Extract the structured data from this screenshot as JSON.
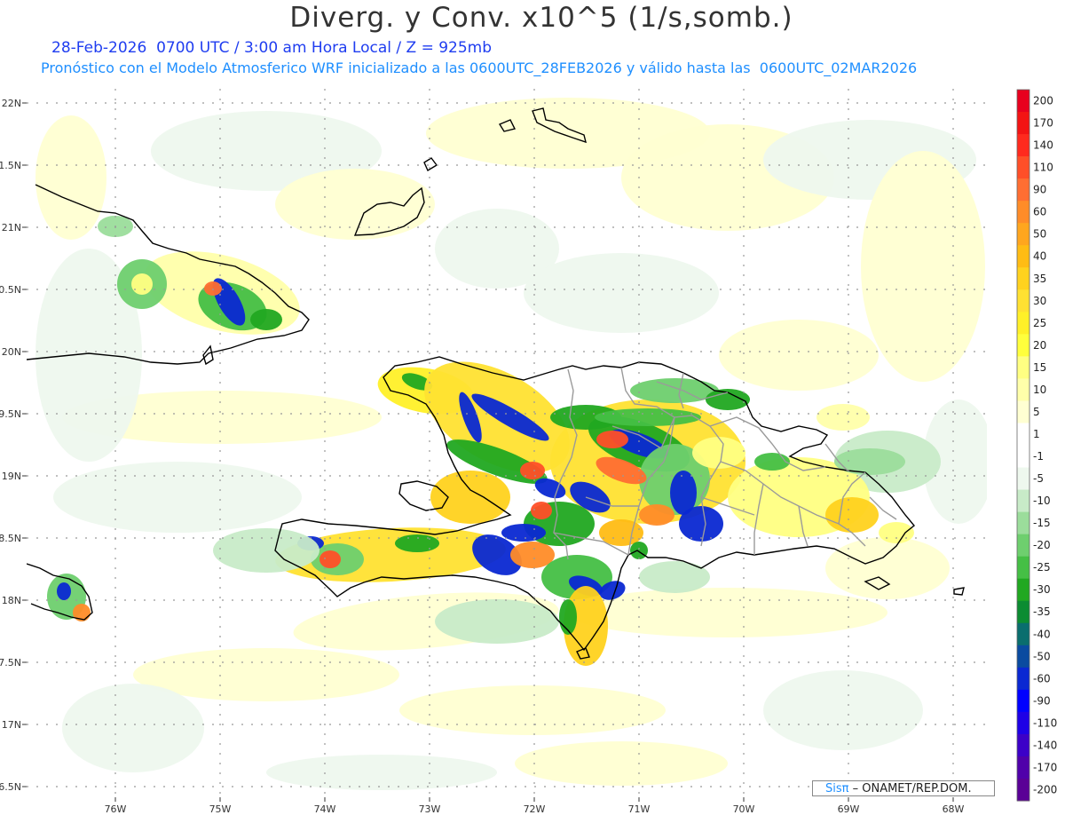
{
  "header": {
    "title": "Diverg. y Conv. x10^5 (1/s,somb.)",
    "subtitle1": "28-Feb-2026  0700 UTC / 3:00 am Hora Local / Z = 925mb",
    "subtitle2": "Pronóstico con el Modelo Atmosferico WRF inicializado a las 0600UTC_28FEB2026 y válido hasta las  0600UTC_02MAR2026"
  },
  "map": {
    "lat_labels": [
      "22N",
      "21.5N",
      "21N",
      "20.5N",
      "20N",
      "19.5N",
      "19N",
      "18.5N",
      "18N",
      "17.5N",
      "17N",
      "16.5N"
    ],
    "lon_labels": [
      "76W",
      "75W",
      "74W",
      "73W",
      "72W",
      "71W",
      "70W",
      "69W",
      "68W"
    ],
    "lat_values": [
      22,
      21.5,
      21,
      20.5,
      20,
      19.5,
      19,
      18.5,
      18,
      17.5,
      17,
      16.5
    ],
    "lon_values": [
      -76,
      -75,
      -74,
      -73,
      -72,
      -71,
      -70,
      -69,
      -68
    ]
  },
  "legend": {
    "labels": [
      "200",
      "170",
      "140",
      "110",
      "90",
      "60",
      "50",
      "40",
      "35",
      "30",
      "25",
      "20",
      "15",
      "10",
      "5",
      "1",
      "-1",
      "-5",
      "-10",
      "-15",
      "-20",
      "-25",
      "-30",
      "-35",
      "-40",
      "-50",
      "-60",
      "-90",
      "-110",
      "-140",
      "-170",
      "-200"
    ],
    "colors": [
      "#e8001e",
      "#f31414",
      "#ff2a1e",
      "#ff4f28",
      "#ff6e32",
      "#ff8c28",
      "#ffa61e",
      "#ffbc14",
      "#ffd21e",
      "#ffe132",
      "#fff028",
      "#ffff3c",
      "#ffff82",
      "#ffffaa",
      "#ffffd2",
      "#ffffff",
      "#ffffff",
      "#eef8ee",
      "#c8ebc8",
      "#9bdd9b",
      "#6ecf6e",
      "#45bf45",
      "#21a821",
      "#0c8c32",
      "#0a6e6e",
      "#0a4ba0",
      "#0a28d2",
      "#0000ff",
      "#1e00e6",
      "#3c00c8",
      "#5000aa",
      "#5a0096"
    ]
  },
  "credit": {
    "sis": "Sisπ",
    "text": "– ONAMET/REP.DOM."
  }
}
